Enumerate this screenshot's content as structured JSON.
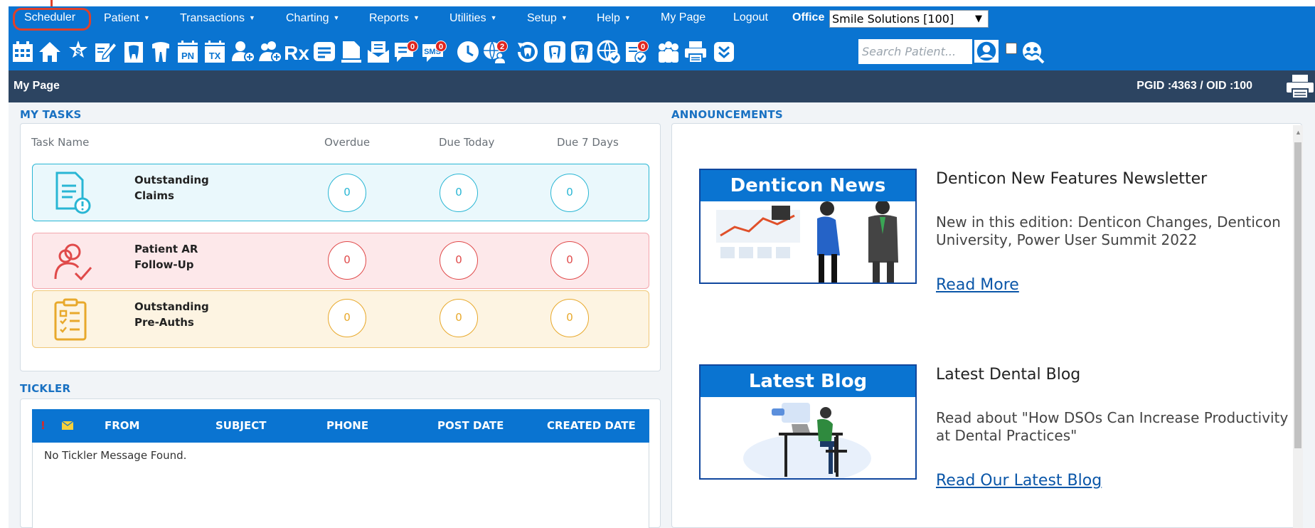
{
  "menu": {
    "items": [
      {
        "label": "Scheduler",
        "caret": false
      },
      {
        "label": "Patient",
        "caret": true
      },
      {
        "label": "Transactions",
        "caret": true
      },
      {
        "label": "Charting",
        "caret": true
      },
      {
        "label": "Reports",
        "caret": true
      },
      {
        "label": "Utilities",
        "caret": true
      },
      {
        "label": "Setup",
        "caret": true
      },
      {
        "label": "Help",
        "caret": true
      },
      {
        "label": "My Page",
        "caret": false
      },
      {
        "label": "Logout",
        "caret": false
      }
    ],
    "caret_glyph": "▼",
    "office_label": "Office",
    "office_value": "Smile Solutions [100]"
  },
  "toolbar": {
    "icons": [
      "calendar-icon",
      "home-icon",
      "dollar-icon",
      "note-edit-icon",
      "tooth-chart-icon",
      "tooth-icon",
      "pn-icon",
      "tx-icon",
      "add-patient-icon",
      "add-family-icon",
      "rx-icon",
      "message-icon",
      "document-icon",
      "mail-icon",
      "chat-icon",
      "sms-icon",
      "clock-icon",
      "global-users-icon",
      "recall-icon",
      "tooth-outline-icon",
      "help-tooth-icon",
      "globe-check-icon",
      "eligibility-icon",
      "group-icon",
      "print-icon",
      "more-icon"
    ],
    "badges": {
      "chat": "0",
      "sms": "0",
      "globe": "2",
      "eligibility": "0"
    },
    "sms_text": "SMS",
    "pn_text": "PN",
    "tx_text": "TX",
    "rx_text": "Rx",
    "search_placeholder": "Search Patient..."
  },
  "header": {
    "title": "My Page",
    "ids": "PGID :4363  /  OID :100"
  },
  "tasks": {
    "section_label": "MY TASKS",
    "columns": {
      "name": "Task Name",
      "overdue": "Overdue",
      "today": "Due Today",
      "week": "Due 7 Days"
    },
    "rows": [
      {
        "name_line1": "Outstanding",
        "name_line2": "Claims",
        "overdue": "0",
        "today": "0",
        "week": "0",
        "color": "#29b6d4",
        "bg": "#eaf8fc"
      },
      {
        "name_line1": "Patient AR",
        "name_line2": "Follow-Up",
        "overdue": "0",
        "today": "0",
        "week": "0",
        "color": "#e04a4a",
        "bg": "#fde8ea"
      },
      {
        "name_line1": "Outstanding",
        "name_line2": "Pre-Auths",
        "overdue": "0",
        "today": "0",
        "week": "0",
        "color": "#e8a92c",
        "bg": "#fdf4e2"
      }
    ]
  },
  "tickler": {
    "section_label": "TICKLER",
    "exclaim": "!",
    "columns": [
      "FROM",
      "SUBJECT",
      "PHONE",
      "POST DATE",
      "CREATED DATE"
    ],
    "empty_message": "No Tickler Message Found."
  },
  "announcements": {
    "section_label": "ANNOUNCEMENTS",
    "items": [
      {
        "banner": "Denticon News",
        "title": "Denticon New Features Newsletter",
        "desc": "New in this edition: Denticon Changes, Denticon University, Power User Summit 2022",
        "link": "Read More"
      },
      {
        "banner": "Latest Blog",
        "title": "Latest Dental Blog",
        "desc": "Read about \"How DSOs Can Increase Productivity at Dental Practices\"",
        "link": "Read Our Latest Blog"
      }
    ]
  }
}
